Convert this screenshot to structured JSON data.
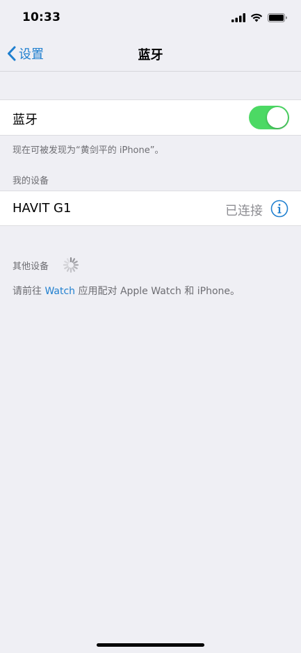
{
  "status_bar": {
    "time": "10:33",
    "icons": [
      "cellular-signal-icon",
      "wifi-icon",
      "battery-icon"
    ]
  },
  "nav": {
    "back_label": "设置",
    "title": "蓝牙"
  },
  "bluetooth": {
    "label": "蓝牙",
    "enabled": true,
    "discoverable_note": "现在可被发现为“黄剑平的 iPhone”。"
  },
  "my_devices": {
    "header": "我的设备",
    "items": [
      {
        "name": "HAVIT G1",
        "status": "已连接"
      }
    ]
  },
  "other_devices": {
    "header": "其他设备",
    "note_prefix": "请前往 ",
    "note_link": "Watch",
    "note_suffix": " 应用配对 Apple Watch 和 iPhone。"
  },
  "colors": {
    "accent": "#1f7fcf",
    "toggle_on": "#4cd964",
    "background": "#efeff4"
  }
}
